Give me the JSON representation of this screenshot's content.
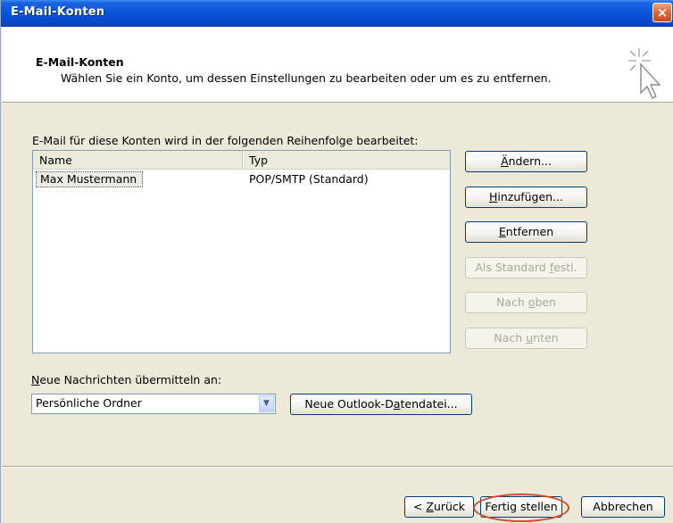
{
  "window": {
    "title": "E-Mail-Konten",
    "close_label": "×"
  },
  "header": {
    "title": "E-Mail-Konten",
    "subtitle": "Wählen Sie ein Konto, um dessen Einstellungen zu bearbeiten oder um es zu entfernen.",
    "icon": "wizard-cursor-icon"
  },
  "accounts": {
    "label": "E-Mail für diese Konten wird in der folgenden Reihenfolge bearbeitet:",
    "columns": [
      "Name",
      "Typ"
    ],
    "rows": [
      {
        "name": "Max Mustermann",
        "type": "POP/SMTP (Standard)"
      }
    ]
  },
  "side_buttons": [
    {
      "text": "Ändern...",
      "accel": "Ä",
      "enabled": true
    },
    {
      "text": "Hinzufügen...",
      "accel": "H",
      "enabled": true
    },
    {
      "text": "Entfernen",
      "accel": "E",
      "enabled": true
    },
    {
      "text": "Als Standard festl.",
      "accel": "f",
      "enabled": false
    },
    {
      "text": "Nach oben",
      "accel": "o",
      "enabled": false
    },
    {
      "text": "Nach unten",
      "accel": "u",
      "enabled": false
    }
  ],
  "delivery": {
    "label": "Neue Nachrichten übermitteln an:",
    "selected": "Persönliche Ordner",
    "new_datafile_button": "Neue Outlook-Datendatei..."
  },
  "footer": {
    "back_button": "< Zurück",
    "finish_button": "Fertig stellen",
    "cancel_button": "Abbrechen",
    "highlight_color": "#d74a28"
  }
}
